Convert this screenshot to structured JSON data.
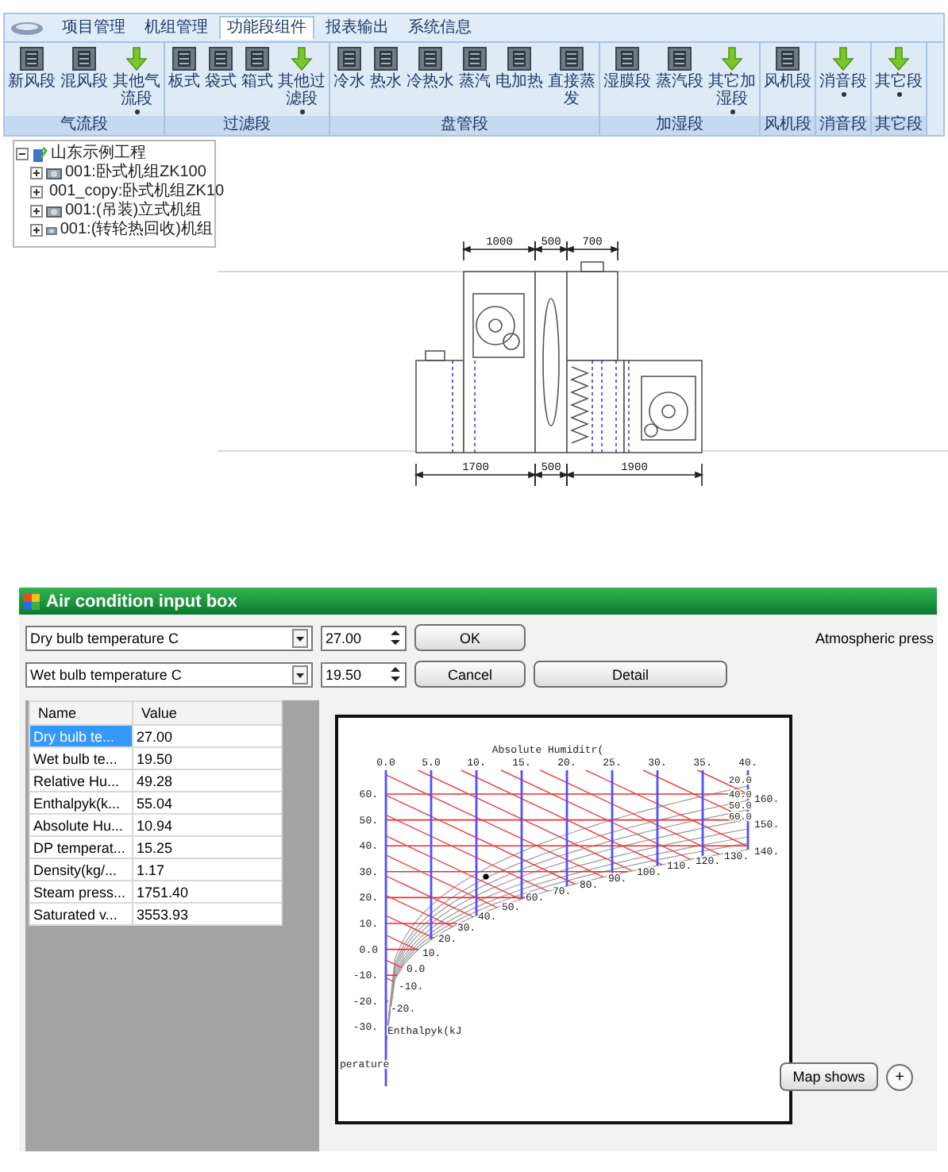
{
  "designer": {
    "tabs": [
      {
        "label": "项目管理",
        "selected": false
      },
      {
        "label": "机组管理",
        "selected": false
      },
      {
        "label": "功能段组件",
        "selected": true
      },
      {
        "label": "报表输出",
        "selected": false
      },
      {
        "label": "系统信息",
        "selected": false
      }
    ],
    "ribbon_groups": [
      {
        "label": "气流段",
        "buttons": [
          {
            "label": "新风段",
            "kind": "tile",
            "menu": false
          },
          {
            "label": "混风段",
            "kind": "tile",
            "menu": false
          },
          {
            "label": "其他气流段",
            "kind": "arrow",
            "menu": true
          }
        ]
      },
      {
        "label": "过滤段",
        "buttons": [
          {
            "label": "板式",
            "kind": "tile",
            "menu": false
          },
          {
            "label": "袋式",
            "kind": "tile",
            "menu": false
          },
          {
            "label": "箱式",
            "kind": "tile",
            "menu": false
          },
          {
            "label": "其他过滤段",
            "kind": "arrow",
            "menu": true
          }
        ]
      },
      {
        "label": "盘管段",
        "buttons": [
          {
            "label": "冷水",
            "kind": "tile",
            "menu": false
          },
          {
            "label": "热水",
            "kind": "tile",
            "menu": false
          },
          {
            "label": "冷热水",
            "kind": "tile",
            "menu": false
          },
          {
            "label": "蒸汽",
            "kind": "tile",
            "menu": false
          },
          {
            "label": "电加热",
            "kind": "tile",
            "menu": false
          },
          {
            "label": "直接蒸发",
            "kind": "tile",
            "menu": false
          }
        ]
      },
      {
        "label": "加湿段",
        "buttons": [
          {
            "label": "湿膜段",
            "kind": "tile",
            "menu": false
          },
          {
            "label": "蒸汽段",
            "kind": "tile",
            "menu": false
          },
          {
            "label": "其它加湿段",
            "kind": "arrow",
            "menu": true
          }
        ]
      },
      {
        "label": "风机段",
        "buttons": [
          {
            "label": "风机段",
            "kind": "tile",
            "menu": false
          }
        ]
      },
      {
        "label": "消音段",
        "buttons": [
          {
            "label": "消音段",
            "kind": "arrow",
            "menu": true
          }
        ]
      },
      {
        "label": "其它段",
        "buttons": [
          {
            "label": "其它段",
            "kind": "arrow",
            "menu": true
          }
        ]
      }
    ],
    "project_tree": {
      "label": "山东示例工程",
      "expanded": true,
      "children": [
        {
          "label": "001:卧式机组ZK100",
          "expanded": false
        },
        {
          "label": "001_copy:卧式机组ZK10",
          "expanded": false
        },
        {
          "label": "001:(吊装)立式机组",
          "expanded": false
        },
        {
          "label": "001:(转轮热回收)机组",
          "expanded": false
        }
      ]
    },
    "drawing": {
      "top_dimensions": [
        "1000",
        "500",
        "700"
      ],
      "bottom_dimensions": [
        "1700",
        "500",
        "1900"
      ]
    }
  },
  "input_box": {
    "title": "Air condition input box",
    "rows": [
      {
        "parameter": "Dry bulb temperature C",
        "value": "27.00",
        "buttons": [
          "OK"
        ]
      },
      {
        "parameter": "Wet bulb temperature C",
        "value": "19.50",
        "buttons": [
          "Cancel",
          "Detail"
        ]
      }
    ],
    "pressure_label": "Atmospheric press",
    "table": {
      "columns": [
        "Name",
        "Value"
      ],
      "rows": [
        {
          "name": "Dry bulb te...",
          "value": "27.00",
          "selected": true
        },
        {
          "name": "Wet bulb te...",
          "value": "19.50",
          "selected": false
        },
        {
          "name": "Relative Hu...",
          "value": "49.28",
          "selected": false
        },
        {
          "name": "Enthalpyk(k...",
          "value": "55.04",
          "selected": false
        },
        {
          "name": "Absolute Hu...",
          "value": "10.94",
          "selected": false
        },
        {
          "name": "DP temperat...",
          "value": "15.25",
          "selected": false
        },
        {
          "name": "Density(kg/...",
          "value": "1.17",
          "selected": false
        },
        {
          "name": "Steam press...",
          "value": "1751.40",
          "selected": false
        },
        {
          "name": "Saturated v...",
          "value": "3553.93",
          "selected": false
        }
      ]
    },
    "chart": {
      "x_title": "Absolute Humiditr(",
      "y_title": "perature",
      "enthalpy_title": "Enthalpyk(kJ",
      "x_ticks": [
        "0.0",
        "5.0",
        "10.",
        "15.",
        "20.",
        "25.",
        "30.",
        "35.",
        "40."
      ],
      "y_ticks": [
        "60.",
        "50.",
        "40.",
        "30.",
        "20.",
        "10.",
        "0.0",
        "-10.",
        "-20.",
        "-30."
      ],
      "enthalpy_labels": [
        "-20.",
        "-10.",
        "0.0",
        "10.",
        "20.",
        "30.",
        "40.",
        "50.",
        "60.",
        "70.",
        "80.",
        "90.",
        "100.",
        "110.",
        "120.",
        "130.",
        "160.",
        "150.",
        "140."
      ],
      "humidity_labels": [
        "20.0",
        "40.0",
        "50.0",
        "60.0"
      ]
    },
    "map_button": "Map shows",
    "plus_button": "+"
  }
}
